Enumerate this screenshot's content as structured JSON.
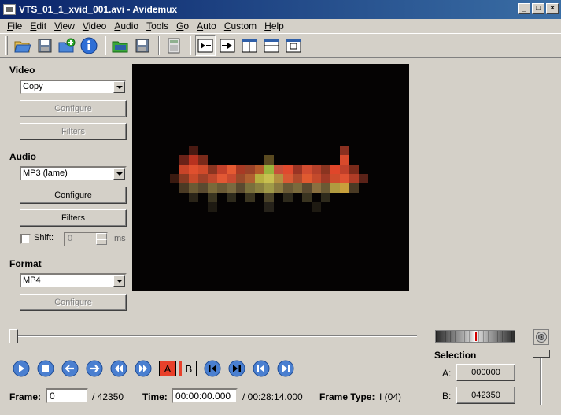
{
  "window": {
    "title": "VTS_01_1_xvid_001.avi - Avidemux"
  },
  "menu": [
    {
      "label": "File",
      "u": "F",
      "rest": "ile"
    },
    {
      "label": "Edit",
      "u": "E",
      "rest": "dit"
    },
    {
      "label": "View",
      "u": "V",
      "rest": "iew"
    },
    {
      "label": "Video",
      "u": "V",
      "rest": "ideo"
    },
    {
      "label": "Audio",
      "u": "A",
      "rest": "udio"
    },
    {
      "label": "Tools",
      "u": "T",
      "rest": "ools"
    },
    {
      "label": "Go",
      "u": "G",
      "rest": "o"
    },
    {
      "label": "Auto",
      "u": "A",
      "rest": "uto"
    },
    {
      "label": "Custom",
      "u": "C",
      "rest": "ustom"
    },
    {
      "label": "Help",
      "u": "H",
      "rest": "elp"
    }
  ],
  "video": {
    "label": "Video",
    "codec": "Copy",
    "configure": "Configure",
    "filters": "Filters"
  },
  "audio": {
    "label": "Audio",
    "codec": "MP3 (lame)",
    "configure": "Configure",
    "filters": "Filters",
    "shift_label": "Shift:",
    "shift_value": "0",
    "ms": "ms"
  },
  "format": {
    "label": "Format",
    "container": "MP4",
    "configure": "Configure"
  },
  "markers": {
    "a": "A",
    "b": "B"
  },
  "status": {
    "frame_label": "Frame:",
    "frame_value": "0",
    "frame_total": "/ 42350",
    "time_label": "Time:",
    "time_value": "00:00:00.000",
    "time_total": "/ 00:28:14.000",
    "frametype_label": "Frame Type:",
    "frametype_value": "I (04)"
  },
  "selection": {
    "title": "Selection",
    "a_label": "A:",
    "a_value": "000000",
    "b_label": "B:",
    "b_value": "042350"
  },
  "colors": {
    "accent": "#3a6ea5",
    "titlebar": "#0a246a",
    "button_blue": "#4a7fd0",
    "marker_red": "#e8402a"
  }
}
